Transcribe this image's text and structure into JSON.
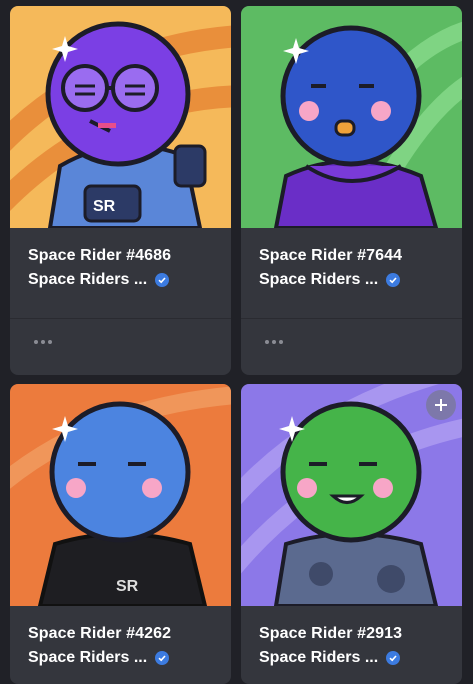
{
  "cards": [
    {
      "title": "Space Rider #4686",
      "collection": "Space Riders ...",
      "verified": true,
      "bg": "#f5b95a",
      "stripe": "#e98f3b",
      "head": "#7b3fe4",
      "suit": "astronaut",
      "more": "more-options"
    },
    {
      "title": "Space Rider #7644",
      "collection": "Space Riders ...",
      "verified": true,
      "bg": "#5dbb63",
      "stripe": "#7fd483",
      "head": "#2f56c9",
      "suit": "purple-sweater",
      "more": "more-options"
    },
    {
      "title": "Space Rider #4262",
      "collection": "Space Riders ...",
      "verified": true,
      "bg": "#ec7b3d",
      "stripe": "#f0965a",
      "head": "#4c84e0",
      "suit": "black-sweater",
      "suit_text": "SR"
    },
    {
      "title": "Space Rider #2913",
      "collection": "Space Riders ...",
      "verified": true,
      "bg": "#8c78e8",
      "stripe": "#a896f0",
      "head": "#45b449",
      "suit": "camo-sweater",
      "add": "plus-icon"
    }
  ],
  "colors": {
    "card_bg": "#34363d",
    "page_bg": "#202127",
    "verified": "#3c7be0"
  },
  "icons": {
    "verified": "verified-badge-icon",
    "more": "more-dots-icon",
    "add": "plus-icon"
  }
}
